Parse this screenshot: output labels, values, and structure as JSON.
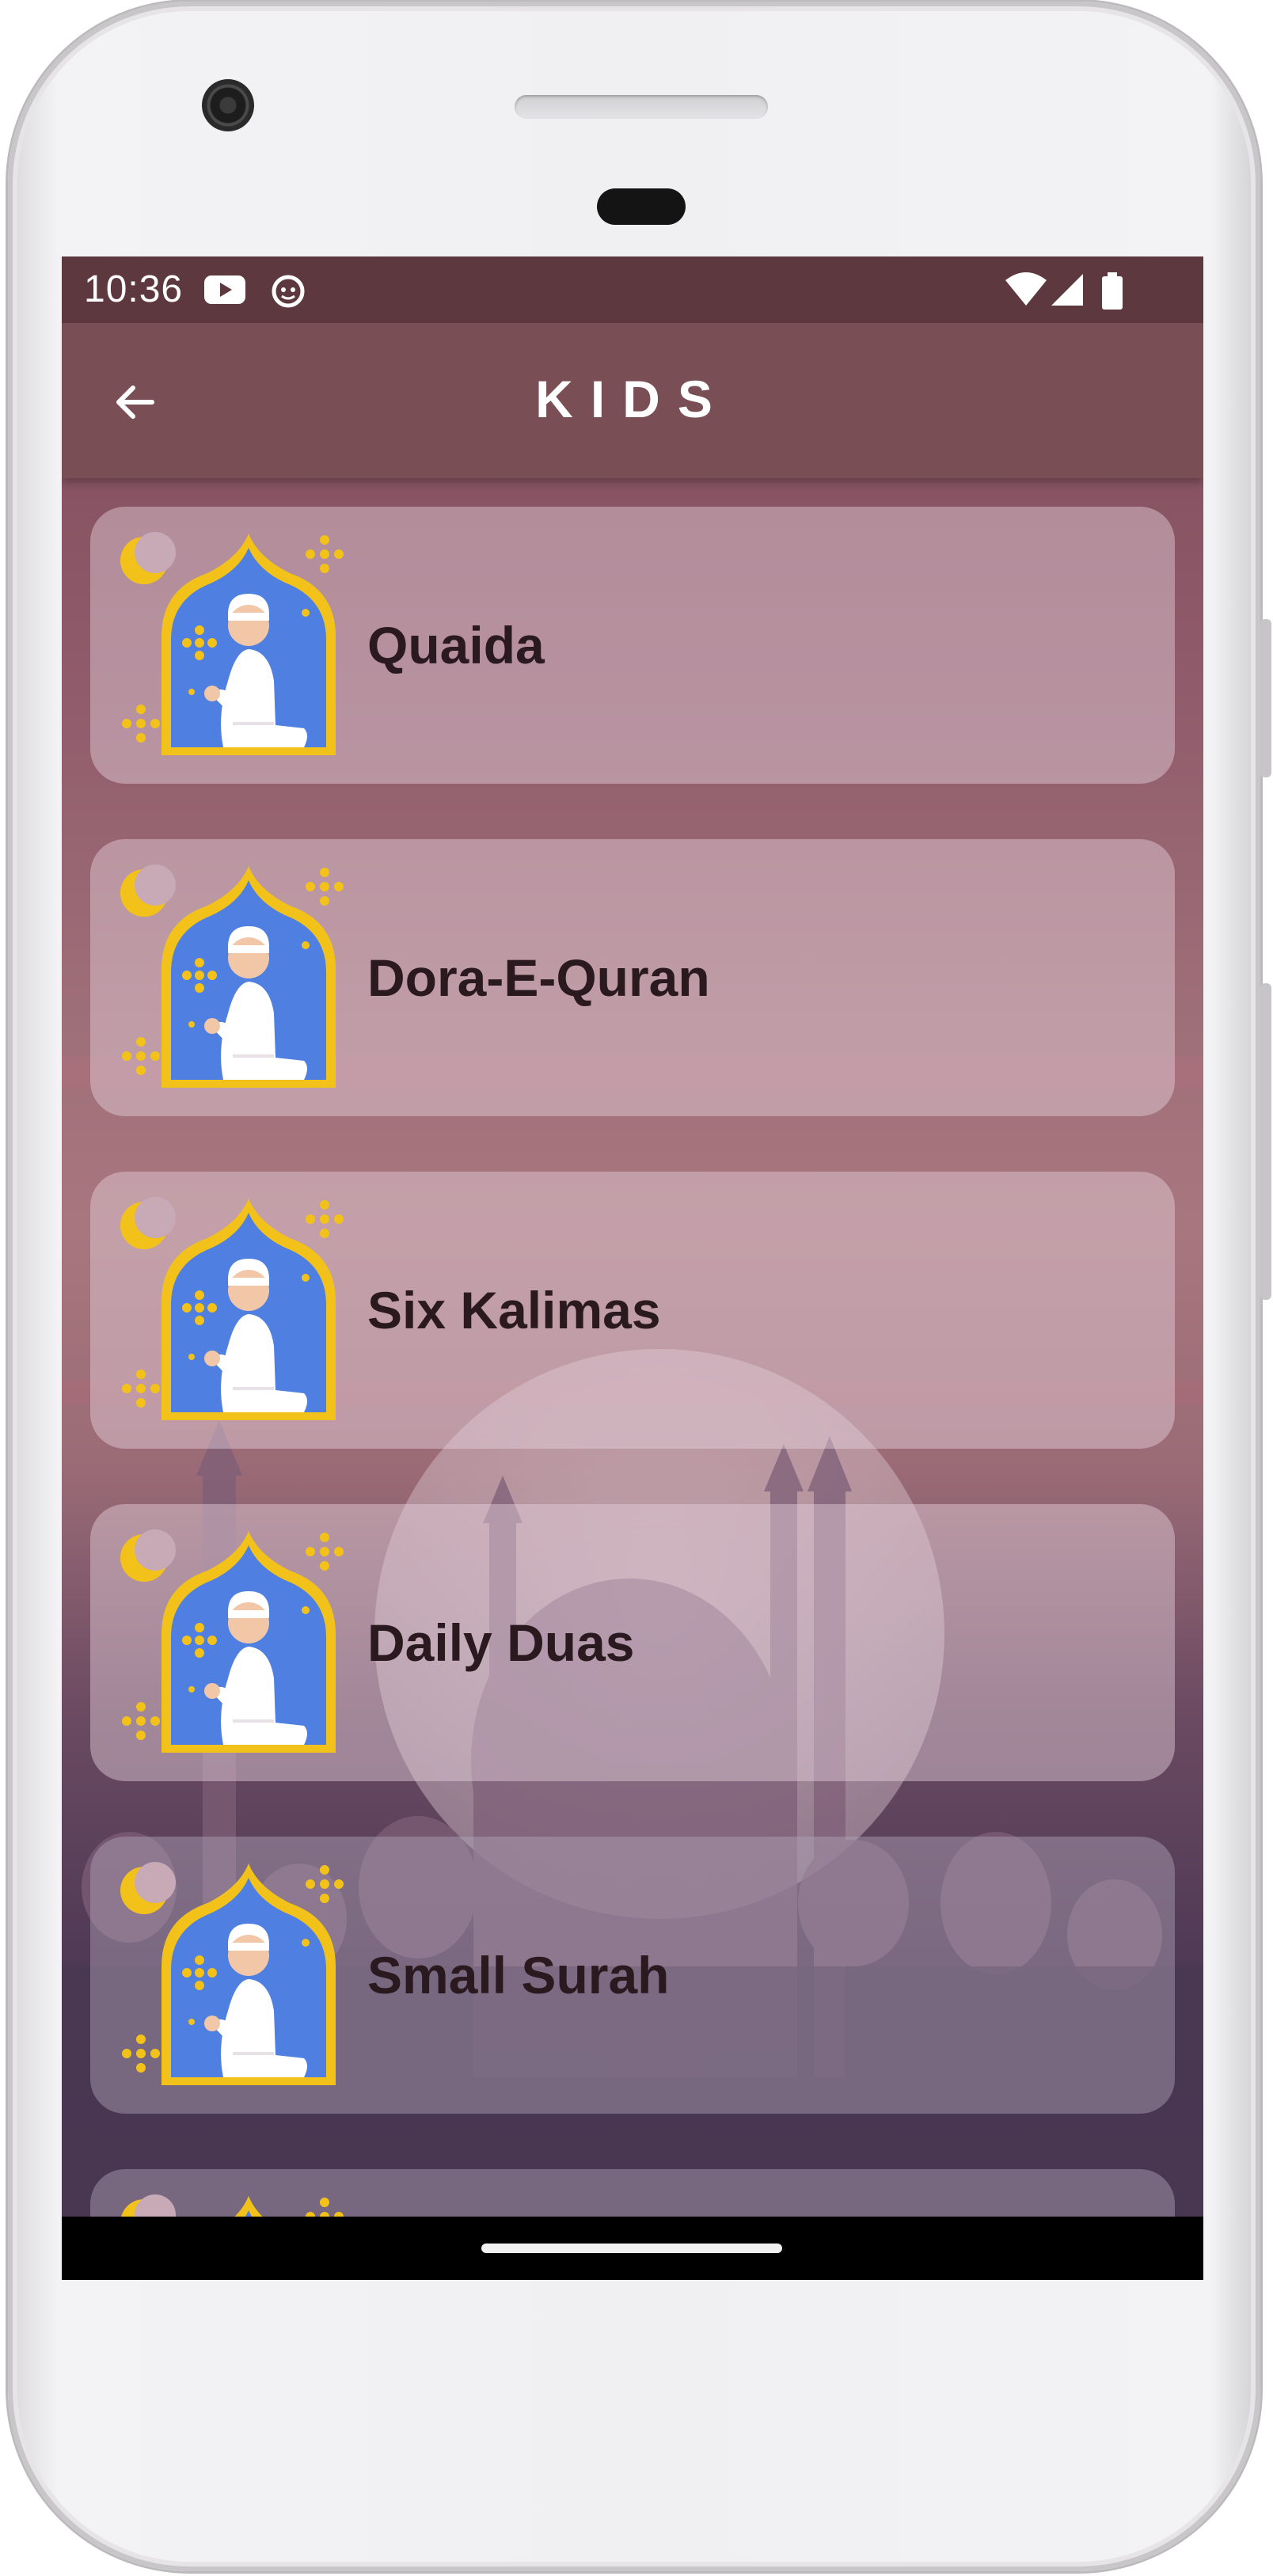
{
  "status_bar": {
    "time": "10:36",
    "icons": [
      "youtube-icon",
      "app-notification-icon",
      "wifi-icon",
      "signal-icon",
      "battery-icon"
    ]
  },
  "app_bar": {
    "title": "KIDS",
    "back_icon": "arrow-back-icon"
  },
  "list": {
    "items": [
      {
        "label": "Quaida",
        "icon": "prayer-kid-icon"
      },
      {
        "label": "Dora-E-Quran",
        "icon": "prayer-kid-icon"
      },
      {
        "label": "Six Kalimas",
        "icon": "prayer-kid-icon"
      },
      {
        "label": "Daily Duas",
        "icon": "prayer-kid-icon"
      },
      {
        "label": "Small Surah",
        "icon": "prayer-kid-icon"
      },
      {
        "label": "",
        "icon": "prayer-kid-icon"
      }
    ]
  },
  "colors": {
    "status_bar": "#5e383f",
    "app_bar": "#7a4e55",
    "icon_blue": "#4f7fe0",
    "icon_gold": "#f2c21b",
    "label_text": "#2a1a20"
  }
}
